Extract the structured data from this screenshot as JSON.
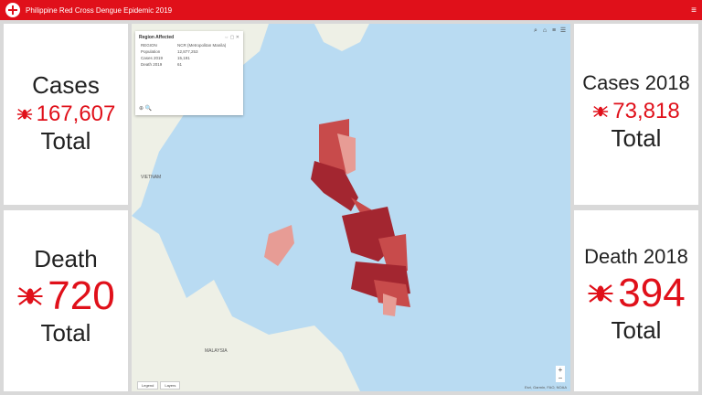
{
  "header": {
    "title": "Philippine Red Cross Dengue Epidemic 2019",
    "menu_icon": "hamburger-menu-icon"
  },
  "cards": {
    "cases": {
      "label": "Cases",
      "value": "167,607",
      "total": "Total"
    },
    "cases_2018": {
      "label": "Cases 2018",
      "value": "73,818",
      "total": "Total"
    },
    "death": {
      "label": "Death",
      "value": "720",
      "total": "Total"
    },
    "death_2018": {
      "label": "Death 2018",
      "value": "394",
      "total": "Total"
    }
  },
  "popup": {
    "title": "Region Affected",
    "rows": [
      {
        "k": "REGION",
        "v": "NCR (Metropolitan Manila)"
      },
      {
        "k": "Population",
        "v": "12,877,253"
      },
      {
        "k": "Cases 2019",
        "v": "15,191"
      },
      {
        "k": "Death 2019",
        "v": "61"
      }
    ]
  },
  "map": {
    "labels": {
      "vietnam": "VIETNAM",
      "malaysia": "MALAYSIA"
    },
    "tabs": [
      "Legend",
      "Layers"
    ],
    "attribution": "Esri, Garmin, FAO, NOAA"
  },
  "colors": {
    "accent": "#e0101a",
    "water": "#b9dbf2",
    "land": "#eef0e6",
    "dark_region": "#a32630",
    "mid_region": "#c84b4b",
    "light_region": "#e79c95"
  }
}
